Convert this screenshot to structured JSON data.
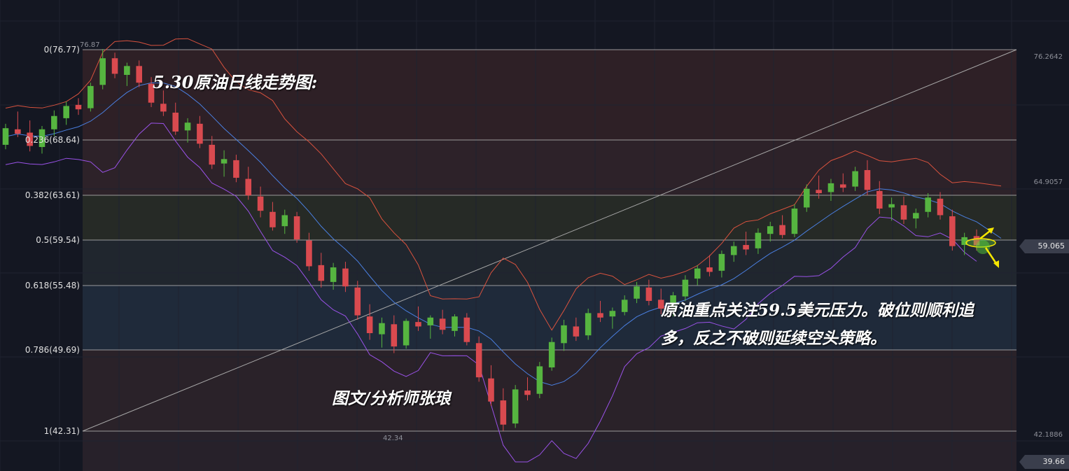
{
  "title": "5.30原油日线走势图:",
  "author": "图文/分析师张琅",
  "note": [
    "原油重点关注59.5美元压力。破位则顺利追",
    "多，反之不破则延续空头策略。"
  ],
  "chart_data": {
    "type": "candlestick",
    "fib_levels": [
      {
        "ratio": "0",
        "price": 76.77,
        "label": "0(76.77)"
      },
      {
        "ratio": "0.236",
        "price": 68.64,
        "label": "0.236(68.64)"
      },
      {
        "ratio": "0.382",
        "price": 63.61,
        "label": "0.382(63.61)"
      },
      {
        "ratio": "0.5",
        "price": 59.54,
        "label": "0.5(59.54)"
      },
      {
        "ratio": "0.618",
        "price": 55.48,
        "label": "0.618(55.48)"
      },
      {
        "ratio": "0.786",
        "price": 49.69,
        "label": "0.786(49.69)"
      },
      {
        "ratio": "1",
        "price": 42.31,
        "label": "1(42.31)"
      }
    ],
    "right_axis_labels": [
      {
        "price": 76.2642,
        "label": "76.2642"
      },
      {
        "price": 64.9057,
        "label": "64.9057"
      },
      {
        "price": 42.1886,
        "label": "42.1886"
      }
    ],
    "current_price": {
      "price": 59.065,
      "label": "59.065"
    },
    "low_price_tag": {
      "price": 39.66,
      "label": "39.66"
    },
    "peak_label": {
      "price": 76.87,
      "label": "76.87"
    },
    "trough_label": {
      "price": 42.34,
      "label": "42.34"
    },
    "colors": {
      "background": "#141722",
      "up": "#56b540",
      "down": "#d94a4f",
      "upper_band": "#d8523e",
      "middle_band": "#4a7fe0",
      "lower_band": "#9a52e8",
      "fib_line": "#b8b8b8",
      "trend_line": "#a8a8a8",
      "arrow": "#f5e600"
    },
    "price_range": [
      39.66,
      79.5
    ],
    "candles": [
      [
        68.2,
        70.1,
        67.8,
        69.7
      ],
      [
        69.6,
        71.2,
        68.9,
        69.2
      ],
      [
        69.3,
        70.4,
        67.6,
        68.1
      ],
      [
        68.0,
        69.9,
        67.4,
        69.6
      ],
      [
        69.6,
        71.3,
        69.0,
        70.8
      ],
      [
        70.6,
        72.1,
        70.0,
        71.7
      ],
      [
        71.8,
        72.4,
        70.9,
        71.4
      ],
      [
        71.5,
        73.8,
        71.2,
        73.5
      ],
      [
        73.6,
        76.87,
        73.2,
        76.0
      ],
      [
        76.0,
        76.5,
        74.2,
        74.6
      ],
      [
        74.5,
        75.6,
        73.5,
        75.3
      ],
      [
        75.3,
        75.8,
        73.4,
        73.8
      ],
      [
        73.7,
        74.3,
        71.6,
        72.0
      ],
      [
        71.9,
        73.1,
        70.8,
        71.2
      ],
      [
        71.1,
        72.0,
        69.1,
        69.4
      ],
      [
        69.5,
        70.6,
        68.4,
        70.2
      ],
      [
        70.1,
        70.8,
        67.9,
        68.3
      ],
      [
        68.2,
        69.0,
        66.0,
        66.4
      ],
      [
        66.5,
        67.7,
        65.3,
        66.9
      ],
      [
        66.8,
        67.3,
        64.8,
        65.2
      ],
      [
        65.1,
        66.2,
        63.2,
        63.6
      ],
      [
        63.5,
        64.4,
        61.6,
        62.2
      ],
      [
        62.1,
        63.0,
        60.4,
        60.7
      ],
      [
        60.8,
        62.3,
        60.1,
        61.8
      ],
      [
        61.7,
        62.1,
        59.3,
        59.6
      ],
      [
        59.5,
        60.2,
        56.8,
        57.2
      ],
      [
        57.3,
        58.4,
        55.3,
        55.9
      ],
      [
        55.8,
        57.5,
        55.1,
        57.1
      ],
      [
        57.0,
        57.6,
        54.9,
        55.4
      ],
      [
        55.3,
        55.9,
        52.4,
        52.8
      ],
      [
        52.7,
        53.8,
        50.6,
        51.2
      ],
      [
        51.1,
        52.6,
        49.9,
        52.1
      ],
      [
        52.0,
        52.8,
        49.4,
        50.0
      ],
      [
        50.1,
        52.5,
        49.8,
        52.3
      ],
      [
        52.2,
        53.6,
        51.4,
        51.8
      ],
      [
        51.9,
        52.8,
        50.7,
        52.6
      ],
      [
        52.5,
        53.3,
        51.1,
        51.5
      ],
      [
        51.4,
        52.9,
        50.9,
        52.7
      ],
      [
        52.6,
        53.0,
        50.1,
        50.4
      ],
      [
        50.3,
        50.9,
        46.8,
        47.2
      ],
      [
        47.1,
        48.3,
        44.6,
        45.0
      ],
      [
        45.1,
        46.2,
        42.34,
        42.9
      ],
      [
        43.0,
        46.5,
        42.6,
        46.1
      ],
      [
        46.0,
        47.2,
        45.1,
        45.6
      ],
      [
        45.7,
        48.6,
        45.3,
        48.2
      ],
      [
        48.1,
        50.8,
        47.8,
        50.4
      ],
      [
        50.3,
        52.4,
        49.6,
        51.9
      ],
      [
        51.8,
        52.6,
        50.5,
        50.9
      ],
      [
        51.0,
        53.4,
        50.6,
        53.0
      ],
      [
        53.0,
        54.1,
        52.2,
        52.6
      ],
      [
        52.7,
        53.5,
        51.6,
        53.2
      ],
      [
        53.1,
        54.6,
        52.8,
        54.2
      ],
      [
        54.3,
        55.8,
        53.9,
        55.4
      ],
      [
        55.3,
        56.0,
        53.7,
        54.1
      ],
      [
        54.2,
        55.2,
        52.9,
        53.4
      ],
      [
        53.5,
        54.9,
        52.7,
        54.6
      ],
      [
        54.5,
        56.4,
        54.1,
        56.0
      ],
      [
        56.1,
        57.3,
        55.5,
        57.0
      ],
      [
        57.1,
        58.2,
        56.3,
        56.7
      ],
      [
        56.8,
        58.6,
        56.2,
        58.3
      ],
      [
        58.2,
        59.4,
        57.6,
        59.0
      ],
      [
        59.1,
        60.3,
        58.2,
        58.7
      ],
      [
        58.8,
        60.6,
        58.3,
        60.2
      ],
      [
        60.1,
        61.2,
        59.4,
        60.8
      ],
      [
        60.9,
        61.8,
        59.7,
        60.0
      ],
      [
        60.1,
        62.8,
        59.8,
        62.4
      ],
      [
        62.5,
        64.6,
        62.1,
        64.2
      ],
      [
        64.1,
        65.4,
        63.3,
        63.8
      ],
      [
        63.9,
        65.1,
        63.1,
        64.7
      ],
      [
        64.6,
        65.6,
        63.9,
        64.3
      ],
      [
        64.4,
        66.2,
        64.0,
        65.8
      ],
      [
        65.9,
        66.8,
        63.6,
        64.1
      ],
      [
        64.0,
        64.9,
        61.9,
        62.4
      ],
      [
        62.5,
        63.4,
        61.3,
        62.8
      ],
      [
        62.7,
        63.5,
        61.0,
        61.4
      ],
      [
        61.5,
        62.4,
        60.6,
        62.0
      ],
      [
        62.1,
        63.8,
        61.6,
        63.4
      ],
      [
        63.3,
        63.9,
        61.4,
        61.8
      ],
      [
        61.7,
        62.3,
        58.6,
        59.0
      ],
      [
        59.1,
        60.2,
        58.2,
        59.8
      ],
      [
        59.9,
        60.5,
        58.6,
        59.065
      ]
    ]
  }
}
